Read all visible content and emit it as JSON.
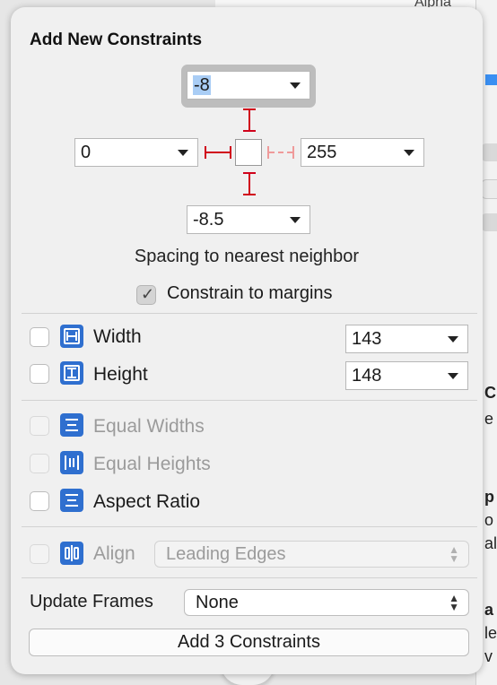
{
  "background": {
    "alpha_label": "Alpha",
    "fragments": [
      "C",
      "e",
      "p",
      "o",
      "al",
      "a",
      "le",
      "v"
    ]
  },
  "title": "Add New Constraints",
  "spacing": {
    "top": "-8",
    "left": "0",
    "right": "255",
    "bottom": "-8.5",
    "caption": "Spacing to nearest neighbor"
  },
  "constrain_margins": {
    "label": "Constrain to margins",
    "checked": true
  },
  "size": {
    "width": {
      "label": "Width",
      "value": "143",
      "checked": false
    },
    "height": {
      "label": "Height",
      "value": "148",
      "checked": false
    }
  },
  "equal": {
    "widths": {
      "label": "Equal Widths",
      "enabled": false
    },
    "heights": {
      "label": "Equal Heights",
      "enabled": false
    },
    "aspect": {
      "label": "Aspect Ratio",
      "enabled": true
    }
  },
  "align": {
    "label": "Align",
    "value": "Leading Edges",
    "enabled": false
  },
  "update_frames": {
    "label": "Update Frames",
    "value": "None"
  },
  "add_button": "Add 3 Constraints",
  "colors": {
    "strut": "#d0021b",
    "icon_blue": "#2f6fcf",
    "selection": "#a9cdf5"
  }
}
